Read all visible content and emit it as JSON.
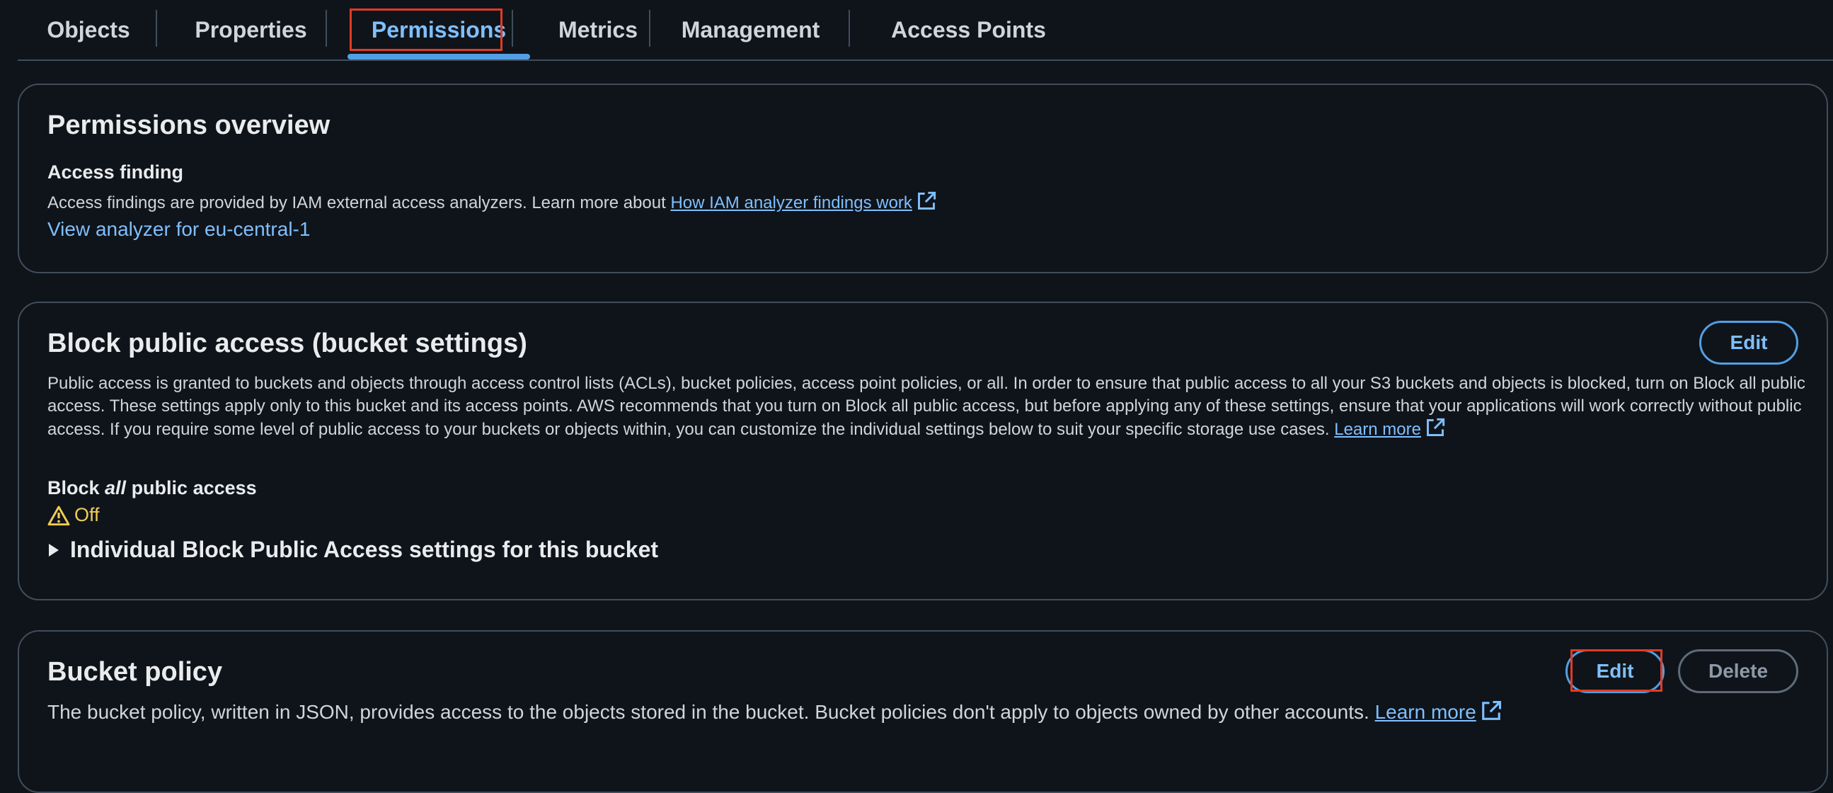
{
  "tabs": [
    {
      "label": "Objects"
    },
    {
      "label": "Properties"
    },
    {
      "label": "Permissions"
    },
    {
      "label": "Metrics"
    },
    {
      "label": "Management"
    },
    {
      "label": "Access Points"
    }
  ],
  "active_tab": "Permissions",
  "overview": {
    "title": "Permissions overview",
    "access_finding_heading": "Access finding",
    "access_finding_text": "Access findings are provided by IAM external access analyzers. Learn more about ",
    "access_finding_link": "How IAM analyzer findings work",
    "view_analyzer_link": "View analyzer for eu-central-1"
  },
  "block_public_access": {
    "title": "Block public access (bucket settings)",
    "edit_label": "Edit",
    "description": "Public access is granted to buckets and objects through access control lists (ACLs), bucket policies, access point policies, or all. In order to ensure that public access to all your S3 buckets and objects is blocked, turn on Block all public access. These settings apply only to this bucket and its access points. AWS recommends that you turn on Block all public access, but before applying any of these settings, ensure that your applications will work correctly without public access. If you require some level of public access to your buckets or objects within, you can customize the individual settings below to suit your specific storage use cases. ",
    "learn_more": "Learn more",
    "block_all_prefix": "Block ",
    "block_all_emphasis": "all",
    "block_all_suffix": " public access",
    "status": "Off",
    "status_color": "#f2cd54",
    "expander_label": "Individual Block Public Access settings for this bucket"
  },
  "bucket_policy": {
    "title": "Bucket policy",
    "edit_label": "Edit",
    "delete_label": "Delete",
    "description": "The bucket policy, written in JSON, provides access to the objects stored in the bucket. Bucket policies don't apply to objects owned by other accounts. ",
    "learn_more": "Learn more"
  },
  "colors": {
    "background": "#0f141a",
    "link": "#7fbfff",
    "border": "#414d5c",
    "highlight": "#e03b24",
    "warning": "#f2cd54"
  }
}
